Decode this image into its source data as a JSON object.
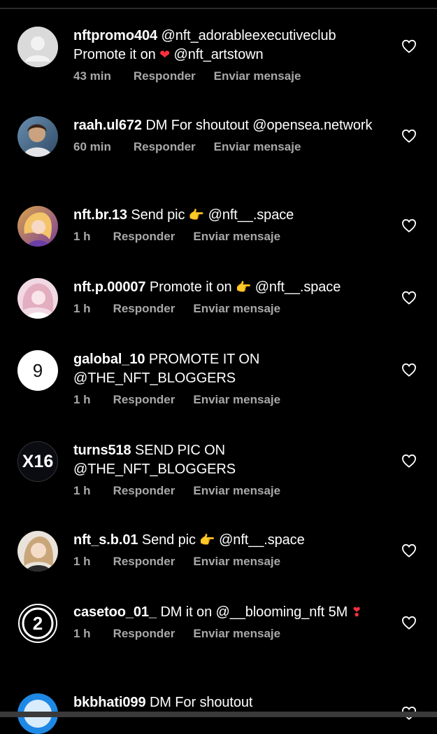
{
  "colors": {
    "background": "#000000",
    "text": "#ffffff",
    "secondary": "#a8a8a8",
    "heart_red": "#ff3040"
  },
  "comments": [
    {
      "username": "nftpromo404",
      "text_a": " @nft_adorableexecutiveclub Promote it on ",
      "emoji": "heart-red",
      "text_b": " @nft_artstown",
      "time": "43 min",
      "reply": "Responder",
      "message": "Enviar mensaje",
      "avatar": "default-avatar-icon"
    },
    {
      "username": "raah.ul672",
      "text_a": " DM For shoutout @opensea.network",
      "time": "60 min",
      "reply": "Responder",
      "message": "Enviar mensaje",
      "avatar": "photo-avatar"
    },
    {
      "username": "nft.br.13",
      "text_a": " Send pic ",
      "emoji": "pointing-right",
      "text_b": " @nft__.space",
      "time": "1 h",
      "reply": "Responder",
      "message": "Enviar mensaje",
      "avatar": "photo-avatar"
    },
    {
      "username": "nft.p.00007",
      "text_a": " Promote it on ",
      "emoji": "pointing-right",
      "text_b": " @nft__.space",
      "time": "1 h",
      "reply": "Responder",
      "message": "Enviar mensaje",
      "avatar": "photo-avatar"
    },
    {
      "username": "galobal_10",
      "text_a": " PROMOTE IT ON @THE_NFT_BLOGGERS",
      "time": "1 h",
      "reply": "Responder",
      "message": "Enviar mensaje",
      "avatar": "logo-avatar",
      "avatar_text": "9"
    },
    {
      "username": "turns518",
      "text_a": " SEND PIC ON @THE_NFT_BLOGGERS",
      "time": "1 h",
      "reply": "Responder",
      "message": "Enviar mensaje",
      "avatar": "logo-avatar",
      "avatar_text": "X16"
    },
    {
      "username": "nft_s.b.01",
      "text_a": " Send pic ",
      "emoji": "pointing-right",
      "text_b": " @nft__.space",
      "time": "1 h",
      "reply": "Responder",
      "message": "Enviar mensaje",
      "avatar": "photo-avatar"
    },
    {
      "username": "casetoo_01_",
      "text_a": " DM it on @__blooming_nft 5M ",
      "emoji": "heart-exclamation",
      "text_b": "",
      "time": "1 h",
      "reply": "Responder",
      "message": "Enviar mensaje",
      "avatar": "logo-avatar",
      "avatar_text": "2"
    },
    {
      "username": "bkbhati099",
      "text_a": " DM For shoutout",
      "avatar": "photo-avatar"
    }
  ]
}
